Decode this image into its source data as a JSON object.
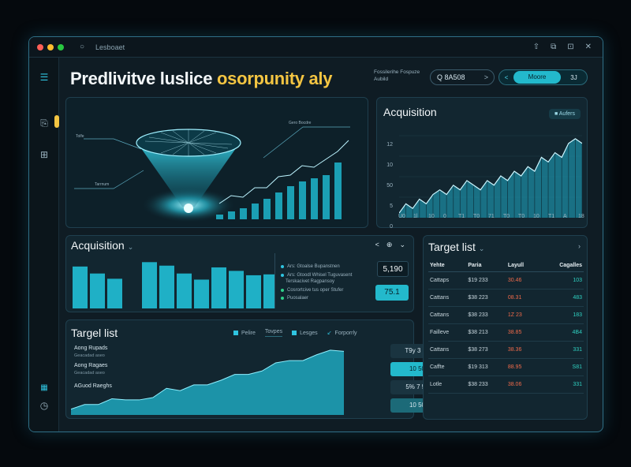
{
  "window": {
    "title": "Lesboaet",
    "controls_right": [
      "⇧",
      "⧉",
      "⊡",
      "✕"
    ]
  },
  "colors": {
    "accent": "#23b9cc",
    "headline_highlight": "#f4c542",
    "negative": "#f06a4a",
    "positive": "#2fd0c0",
    "traffic_red": "#ff5f57",
    "traffic_yellow": "#febc2e",
    "traffic_green": "#28c840"
  },
  "sidebar": {
    "icons": [
      "menu-icon",
      "clipboard-icon",
      "chart-icon",
      "grid-icon",
      "clock-icon"
    ]
  },
  "header": {
    "title_part1": "Predlivitve luslice ",
    "title_part2": "osorpunity aly",
    "note": "Fossilerihe Fospuze Aubild",
    "search_value": "Q 8A508",
    "toggle_left": "<",
    "toggle_active": "Moore",
    "toggle_right": "3J"
  },
  "hero": {
    "label_left_top": "Tolfe",
    "label_left_mid": "Tarrnum",
    "label_right_top": "Gero Bocdre"
  },
  "acquisition_top": {
    "title": "Acquisition",
    "badge": "Aufers",
    "yticks": [
      "12",
      "10",
      "50",
      "5",
      "0"
    ],
    "xticks": [
      "U0",
      "1l",
      "10",
      "0",
      "T1",
      "T0",
      "71",
      "T0",
      "T0",
      "10",
      "T1",
      "A",
      "18"
    ],
    "chart_data": {
      "type": "area",
      "values": [
        1,
        3,
        2,
        4,
        3,
        5,
        6,
        5,
        7,
        6,
        8,
        7,
        6,
        8,
        7,
        9,
        8,
        10,
        9,
        11,
        10,
        13,
        12,
        14,
        13,
        16,
        17,
        16
      ]
    }
  },
  "acquisition_mid": {
    "title": "Acquisition",
    "controls": [
      "<",
      "⊕",
      "⌄"
    ],
    "chart_data": {
      "type": "bar",
      "values": [
        48,
        40,
        34,
        0,
        53,
        49,
        40,
        33,
        47,
        43,
        38,
        39
      ]
    },
    "legend": [
      "Ars: Gtoalse Bupanstnen",
      "Ars: Gtoodl Whisel Tuguvasent",
      "Terskacivet Ragpansoy",
      "Cosrortcive tus oper Stufer",
      "Puosalaer"
    ],
    "value_top": "5,190",
    "value_bottom": "75.1"
  },
  "target_bottom": {
    "title": "Targel list",
    "tabs": [
      "Pelire",
      "Tovpes",
      "Lesges",
      "Forporrly"
    ],
    "rows": [
      {
        "label": "Aong Rupads",
        "sub": "Geacadad aseo"
      },
      {
        "label": "Aong Ragaes",
        "sub": "Geacadad aseo"
      },
      {
        "label": "AGuod Raeghs",
        "sub": ""
      }
    ],
    "boxes": [
      "T9y 3 80",
      "10 50",
      "5% 7 50",
      "10 50"
    ],
    "chart_data": {
      "type": "area",
      "values": [
        5,
        9,
        9,
        14,
        13,
        13,
        15,
        23,
        21,
        26,
        26,
        30,
        35,
        35,
        38,
        45,
        47,
        47,
        52,
        56,
        55
      ]
    }
  },
  "target_right": {
    "title": "Target list",
    "columns": [
      "Yehte",
      "Paria",
      "Layull",
      "Cagalles"
    ],
    "rows": [
      [
        "Cattaps",
        "$19 233",
        "30.46",
        "103"
      ],
      [
        "Cattans",
        "$38 223",
        "08.31",
        "483"
      ],
      [
        "Cattans",
        "$38 233",
        "1Z 23",
        "183"
      ],
      [
        "Failleve",
        "$38 213",
        "38.85",
        "4B4"
      ],
      [
        "Cattans",
        "$38 273",
        "38.36",
        "331"
      ],
      [
        "Caffte",
        "$19 313",
        "88.95",
        "S81"
      ],
      [
        "Lotle",
        "$38 233",
        "38.06",
        "331"
      ]
    ]
  }
}
